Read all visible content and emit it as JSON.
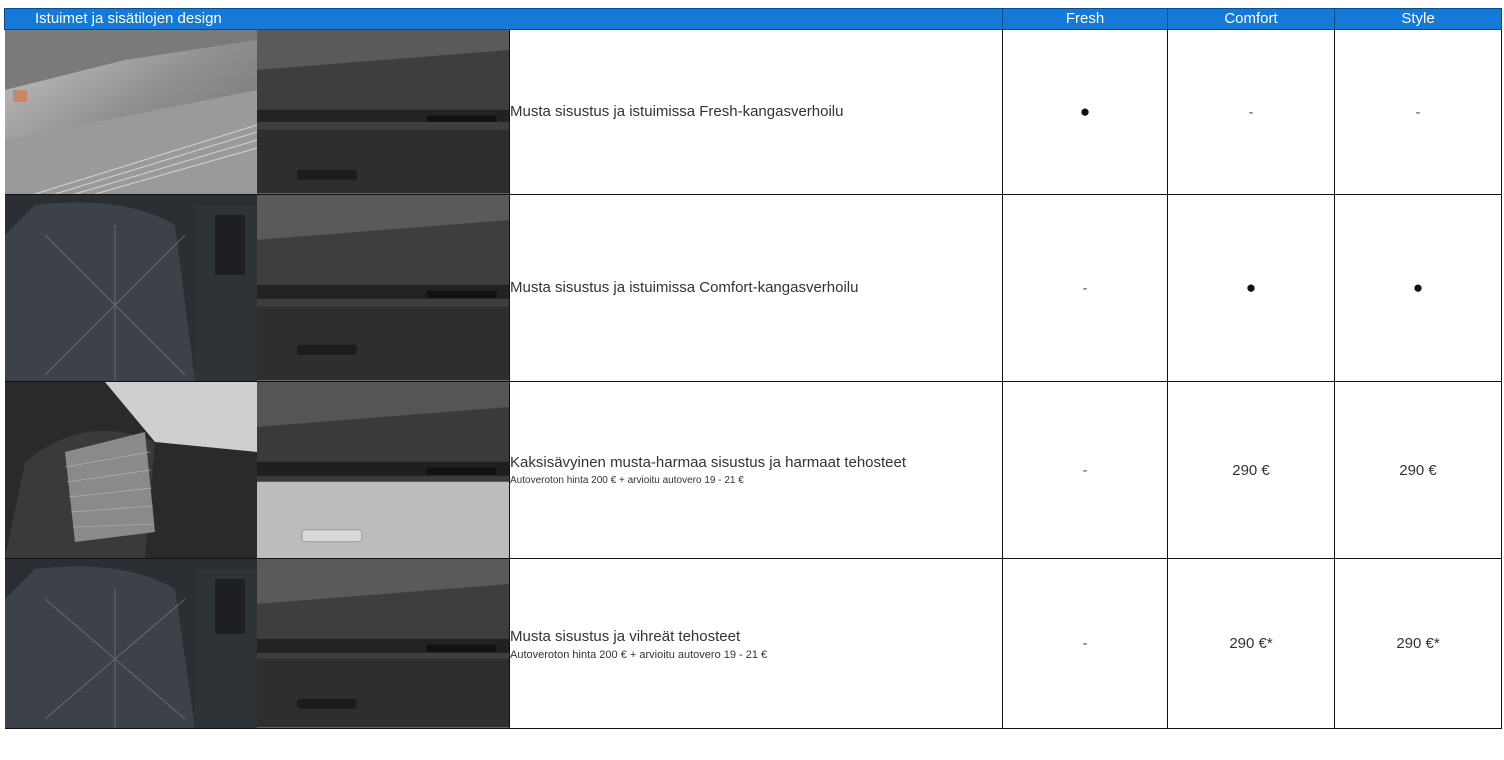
{
  "header": {
    "title": "Istuimet ja sisätilojen design",
    "trims": [
      "Fresh",
      "Comfort",
      "Style"
    ]
  },
  "rows": [
    {
      "description": "Musta sisustus ja istuimissa Fresh-kangasverhoilu",
      "note": "",
      "values": [
        "●",
        "-",
        "-"
      ],
      "seat_image": "seat-fresh-fabric",
      "dash_image": "dashboard-black"
    },
    {
      "description": "Musta sisustus ja istuimissa Comfort-kangasverhoilu",
      "note": "",
      "values": [
        "-",
        "●",
        "●"
      ],
      "seat_image": "seat-comfort-fabric",
      "dash_image": "dashboard-black"
    },
    {
      "description": "Kaksisävyinen musta-harmaa sisustus ja harmaat tehosteet",
      "note": "Autoveroton hinta 200 € + arvioitu autovero 19 - 21 €",
      "values": [
        "-",
        "290 €",
        "290 €"
      ],
      "seat_image": "seat-two-tone-grey",
      "dash_image": "dashboard-grey"
    },
    {
      "description": "Musta sisustus ja vihreät tehosteet",
      "note": "Autoveroton hinta 200 € + arvioitu autovero 19 - 21 €",
      "values": [
        "-",
        "290 €*",
        "290 €*"
      ],
      "seat_image": "seat-green-accents",
      "dash_image": "dashboard-black"
    }
  ],
  "colors": {
    "header_bg": "#1479d9",
    "header_text": "#ffffff",
    "border": "#111111"
  }
}
